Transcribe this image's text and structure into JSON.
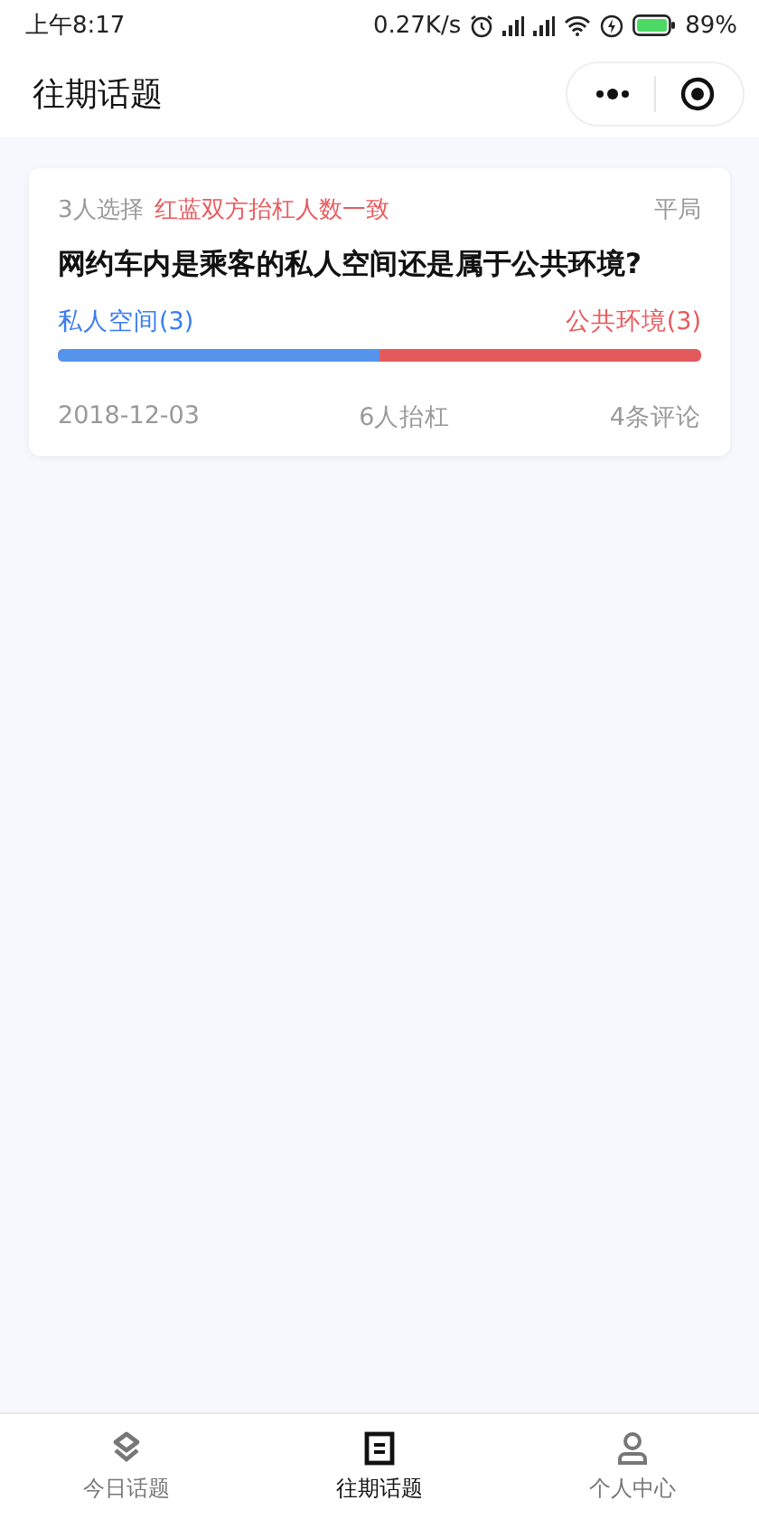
{
  "status_bar": {
    "time": "上午8:17",
    "speed": "0.27K/s",
    "battery": "89%"
  },
  "header": {
    "title": "往期话题"
  },
  "topics": [
    {
      "count": "3人选择",
      "note": "红蓝双方抬杠人数一致",
      "result": "平局",
      "question": "网约车内是乘客的私人空间还是属于公共环境?",
      "left": "私人空间(3)",
      "right": "公共环境(3)",
      "level": 0.5,
      "date": "2018-12-03",
      "people": "6人抬杠",
      "comments": "4条评论"
    }
  ],
  "tabs": [
    {
      "label": "今日话题",
      "kind": "layers",
      "selected": false
    },
    {
      "label": "往期话题",
      "kind": "list",
      "selected": true
    },
    {
      "label": "个人中心",
      "kind": "person",
      "selected": false
    }
  ]
}
